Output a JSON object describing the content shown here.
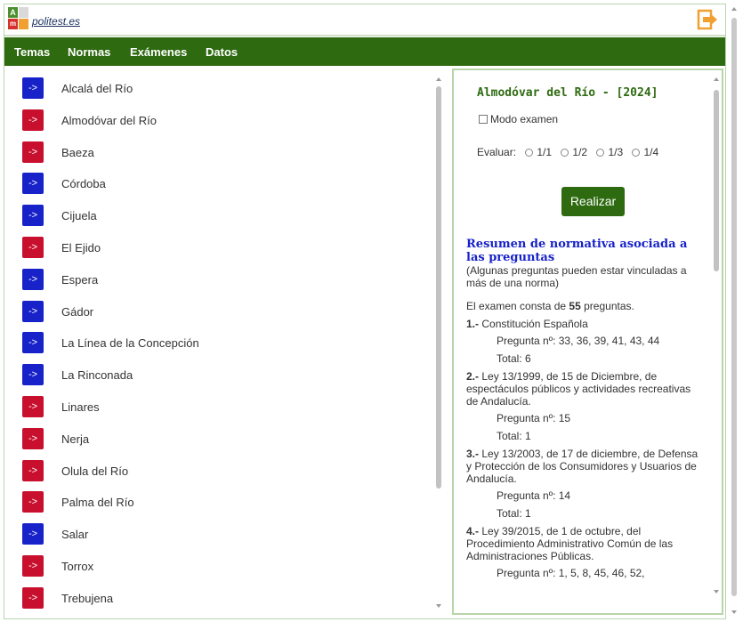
{
  "header": {
    "brand": "politest.es",
    "logo_letters": [
      "A",
      "m"
    ],
    "exit_icon": "logout-icon"
  },
  "nav": {
    "items": [
      "Temas",
      "Normas",
      "Exámenes",
      "Datos"
    ]
  },
  "colors": {
    "nav_bg": "#2e6a10",
    "blue_button": "#1722c9",
    "red_button": "#c8102e",
    "heading_blue": "#1722c9",
    "panel_title_green": "#2e6a10",
    "exit_orange": "#f0a030"
  },
  "list": {
    "button_label": "->",
    "items": [
      {
        "name": "Alcalá del Río",
        "color": "blue"
      },
      {
        "name": "Almodóvar del Río",
        "color": "red"
      },
      {
        "name": "Baeza",
        "color": "red"
      },
      {
        "name": "Córdoba",
        "color": "blue"
      },
      {
        "name": "Cijuela",
        "color": "blue"
      },
      {
        "name": "El Ejido",
        "color": "red"
      },
      {
        "name": "Espera",
        "color": "blue"
      },
      {
        "name": "Gádor",
        "color": "blue"
      },
      {
        "name": "La Línea de la Concepción",
        "color": "blue"
      },
      {
        "name": "La Rinconada",
        "color": "blue"
      },
      {
        "name": "Linares",
        "color": "red"
      },
      {
        "name": "Nerja",
        "color": "red"
      },
      {
        "name": "Olula del Río",
        "color": "red"
      },
      {
        "name": "Palma del Río",
        "color": "red"
      },
      {
        "name": "Salar",
        "color": "blue"
      },
      {
        "name": "Torrox",
        "color": "red"
      },
      {
        "name": "Trebujena",
        "color": "red"
      }
    ]
  },
  "panel": {
    "title": "Almodóvar del Río - [2024]",
    "modo_examen": "Modo examen",
    "evaluar_label": "Evaluar:",
    "evaluar_options": [
      "1/1",
      "1/2",
      "1/3",
      "1/4"
    ],
    "realizar": "Realizar",
    "summary_heading": "Resumen de normativa asociada a las preguntas",
    "summary_note": "(Algunas preguntas pueden estar vinculadas a más de una norma)",
    "exam_text_pre": "El examen consta de",
    "exam_count": "55",
    "exam_text_post": "preguntas.",
    "laws": [
      {
        "num": "1.-",
        "text": "Constitución Española",
        "preguntas": "Pregunta nº: 33, 36, 39, 41, 43, 44",
        "total": "Total: 6"
      },
      {
        "num": "2.-",
        "text": "Ley 13/1999, de 15 de Diciembre, de espectáculos públicos y actividades recreativas de Andalucía.",
        "preguntas": "Pregunta nº: 15",
        "total": "Total: 1"
      },
      {
        "num": "3.-",
        "text": "Ley 13/2003, de 17 de diciembre, de Defensa y Protección de los Consumidores y Usuarios de Andalucía.",
        "preguntas": "Pregunta nº: 14",
        "total": "Total: 1"
      },
      {
        "num": "4.-",
        "text": "Ley 39/2015, de 1 de octubre, del Procedimiento Administrativo Común de las Administraciones Públicas.",
        "preguntas": "Pregunta nº: 1, 5, 8, 45, 46, 52,"
      }
    ]
  }
}
